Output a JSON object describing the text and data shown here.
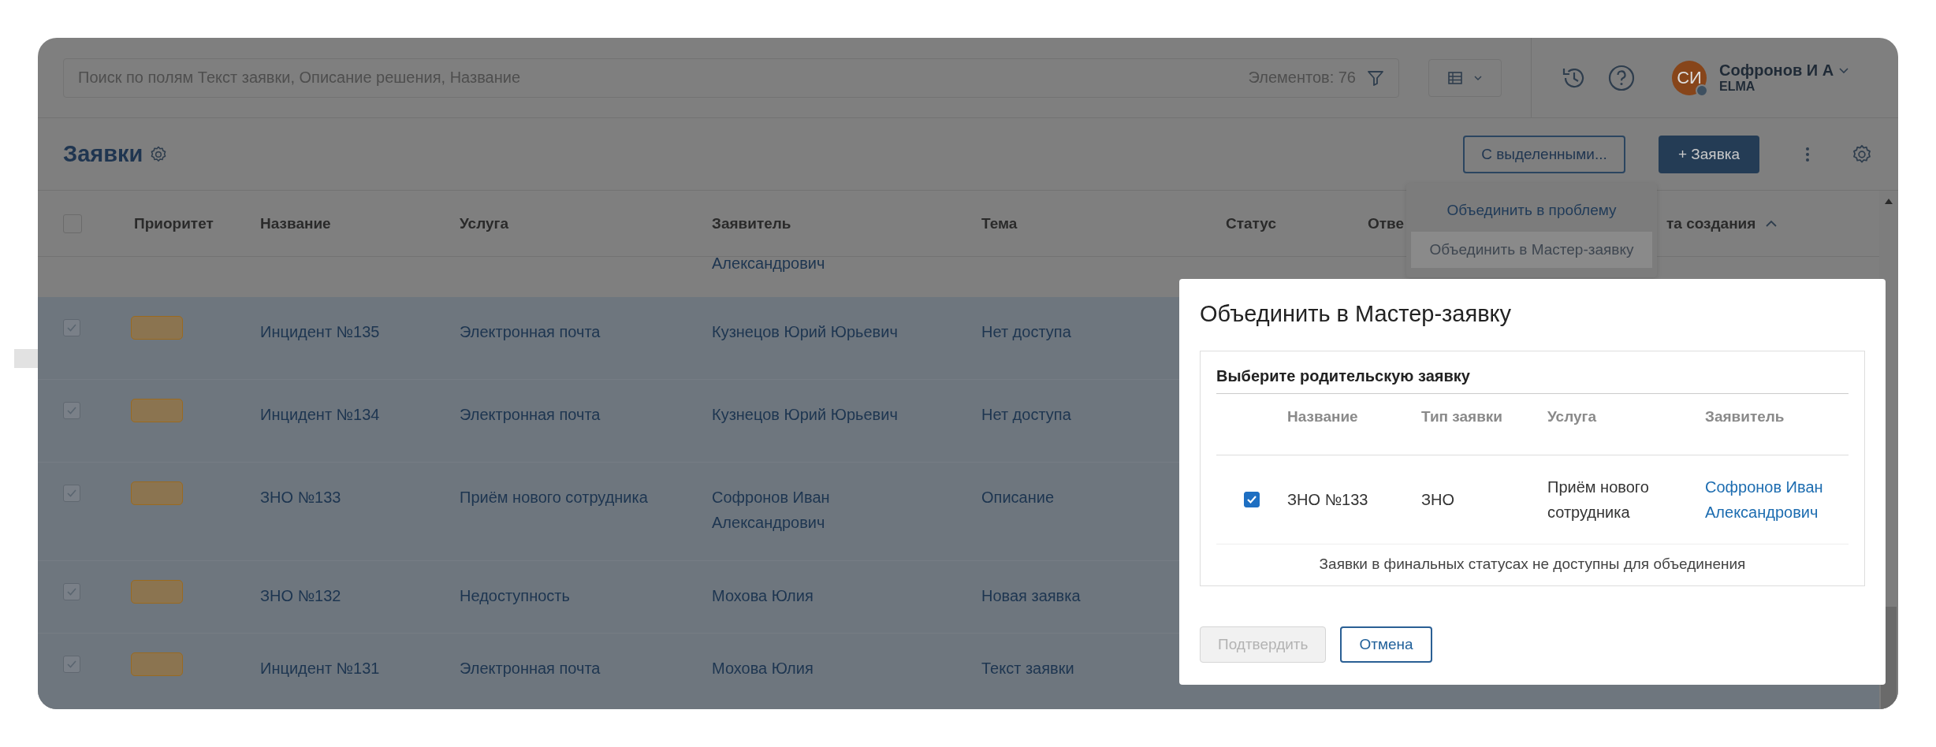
{
  "search": {
    "placeholder": "Поиск по полям Текст заявки, Описание решения, Название",
    "count": "Элементов: 76"
  },
  "user": {
    "initials": "СИ",
    "name": "Софронов И А",
    "org": "ELMA"
  },
  "page": {
    "title": "Заявки"
  },
  "toolbar": {
    "bulk_button": "С выделенными...",
    "create_button": "+ Заявка"
  },
  "bulk_menu": [
    {
      "label": "Объединить в проблему",
      "selected": false
    },
    {
      "label": "Объединить в Мастер-заявку",
      "selected": true
    }
  ],
  "table": {
    "header_checked": false,
    "columns": [
      {
        "label": "Приоритет",
        "sorted": false
      },
      {
        "label": "Название",
        "sorted": false
      },
      {
        "label": "Услуга",
        "sorted": false
      },
      {
        "label": "Заявитель",
        "sorted": false
      },
      {
        "label": "Тема",
        "sorted": false
      },
      {
        "label": "Статус",
        "sorted": false
      },
      {
        "label": "Отве",
        "sorted": false
      },
      {
        "label": "та создания",
        "sorted": true
      }
    ],
    "partial_row": {
      "applicant": "Александрович"
    },
    "rows": [
      {
        "selected": true,
        "name": "Инцидент №135",
        "service": "Электронная почта",
        "applicant": "Кузнецов Юрий Юрьевич",
        "topic": "Нет доступа"
      },
      {
        "selected": true,
        "name": "Инцидент №134",
        "service": "Электронная почта",
        "applicant": "Кузнецов Юрий Юрьевич",
        "topic": "Нет доступа"
      },
      {
        "selected": true,
        "name": "ЗНО №133",
        "service": "Приём нового сотрудника",
        "applicant": "Софронов Иван Александрович",
        "topic": "Описание"
      },
      {
        "selected": true,
        "name": "ЗНО №132",
        "service": "Недоступность",
        "applicant": "Мохова Юлия",
        "topic": "Новая заявка"
      },
      {
        "selected": true,
        "name": "Инцидент №131",
        "service": "Электронная почта",
        "applicant": "Мохова Юлия",
        "topic": "Текст заявки"
      }
    ]
  },
  "dialog": {
    "title": "Объединить в Мастер-заявку",
    "section": "Выберите родительскую заявку",
    "columns": [
      "Название",
      "Тип заявки",
      "Услуга",
      "Заявитель"
    ],
    "rows": [
      {
        "checked": true,
        "name": "ЗНО №133",
        "type": "ЗНО",
        "service": "Приём нового сотрудника",
        "applicant": "Софронов Иван Александрович"
      }
    ],
    "note": "Заявки в финальных статусах не доступны для объединения",
    "confirm": {
      "label": "Подтвердить",
      "disabled": true
    },
    "cancel": {
      "label": "Отмена"
    }
  }
}
